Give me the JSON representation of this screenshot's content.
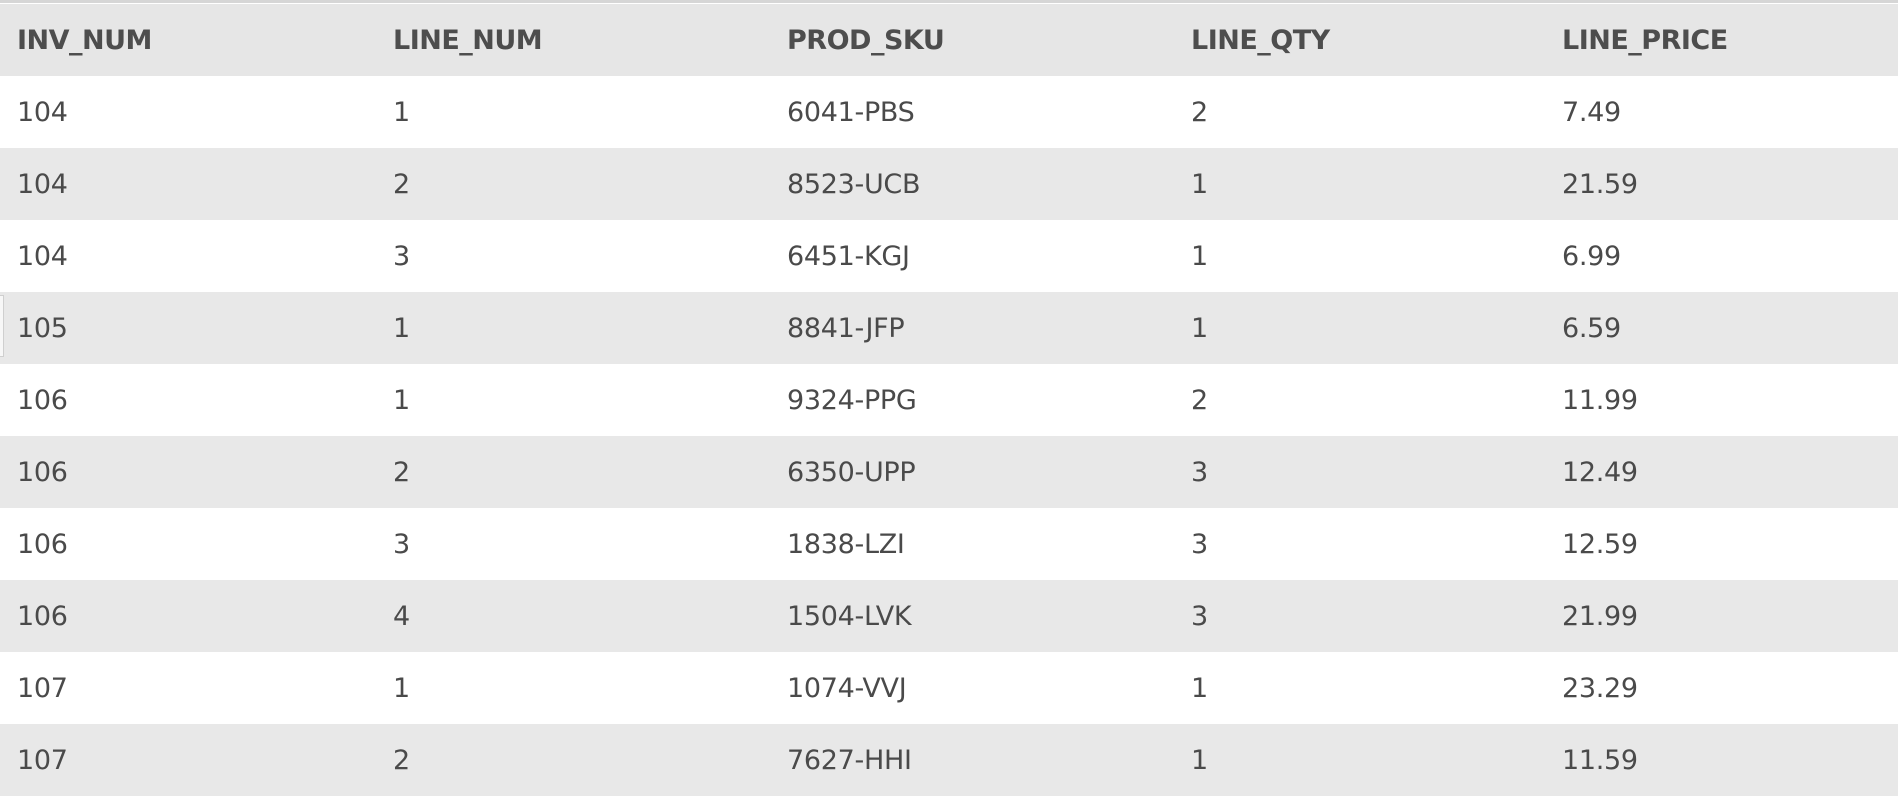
{
  "table": {
    "columns": [
      "INV_NUM",
      "LINE_NUM",
      "PROD_SKU",
      "LINE_QTY",
      "LINE_PRICE"
    ],
    "rows": [
      [
        "104",
        "1",
        "6041-PBS",
        "2",
        "7.49"
      ],
      [
        "104",
        "2",
        "8523-UCB",
        "1",
        "21.59"
      ],
      [
        "104",
        "3",
        "6451-KGJ",
        "1",
        "6.99"
      ],
      [
        "105",
        "1",
        "8841-JFP",
        "1",
        "6.59"
      ],
      [
        "106",
        "1",
        "9324-PPG",
        "2",
        "11.99"
      ],
      [
        "106",
        "2",
        "6350-UPP",
        "3",
        "12.49"
      ],
      [
        "106",
        "3",
        "1838-LZI",
        "3",
        "12.59"
      ],
      [
        "106",
        "4",
        "1504-LVK",
        "3",
        "21.99"
      ],
      [
        "107",
        "1",
        "1074-VVJ",
        "1",
        "23.29"
      ],
      [
        "107",
        "2",
        "7627-HHI",
        "1",
        "11.59"
      ]
    ]
  }
}
